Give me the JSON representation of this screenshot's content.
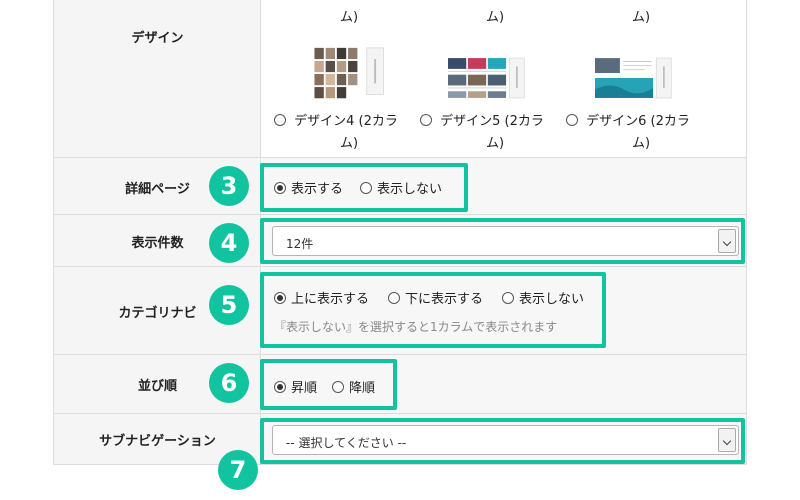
{
  "design": {
    "label": "デザイン",
    "top_fragments": [
      "ム)",
      "ム)",
      "ム)"
    ],
    "options": [
      {
        "line1": "デザイン4 (2カラ",
        "line2": "ム)",
        "selected": false
      },
      {
        "line1": "デザイン5 (2カラ",
        "line2": "ム)",
        "selected": false
      },
      {
        "line1": "デザイン6 (2カラ",
        "line2": "ム)",
        "selected": false
      }
    ]
  },
  "detail_page": {
    "label": "詳細ページ",
    "badge": "3",
    "options": [
      {
        "label": "表示する",
        "selected": true
      },
      {
        "label": "表示しない",
        "selected": false
      }
    ]
  },
  "display_count": {
    "label": "表示件数",
    "badge": "4",
    "value": "12件"
  },
  "category_nav": {
    "label": "カテゴリナビ",
    "badge": "5",
    "options": [
      {
        "label": "上に表示する",
        "selected": true
      },
      {
        "label": "下に表示する",
        "selected": false
      },
      {
        "label": "表示しない",
        "selected": false
      }
    ],
    "note": "『表示しない』を選択すると1カラムで表示されます"
  },
  "sort_order": {
    "label": "並び順",
    "badge": "6",
    "options": [
      {
        "label": "昇順",
        "selected": true
      },
      {
        "label": "降順",
        "selected": false
      }
    ]
  },
  "sub_navigation": {
    "label": "サブナビゲーション",
    "badge": "7",
    "value": "-- 選択してください --"
  },
  "colors": {
    "highlight": "#12c3a0",
    "label_bg": "#f5f5f5",
    "border": "#dcdcdc"
  }
}
